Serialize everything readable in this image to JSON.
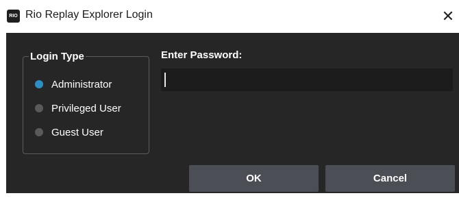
{
  "window": {
    "title": "Rio Replay Explorer Login",
    "app_icon_text": "RIO",
    "close_glyph": "✕"
  },
  "login_type": {
    "legend": "Login Type",
    "options": [
      {
        "label": "Administrator",
        "checked": true
      },
      {
        "label": "Privileged User",
        "checked": false
      },
      {
        "label": "Guest User",
        "checked": false
      }
    ]
  },
  "password": {
    "label": "Enter Password:",
    "value": ""
  },
  "buttons": {
    "ok_label": "OK",
    "cancel_label": "Cancel"
  },
  "colors": {
    "background": "#262626",
    "input_background": "#1c1c1c",
    "button_background": "#4b4e55",
    "radio_checked": "#2d8ec4",
    "radio_unchecked": "#5a5a5a"
  }
}
